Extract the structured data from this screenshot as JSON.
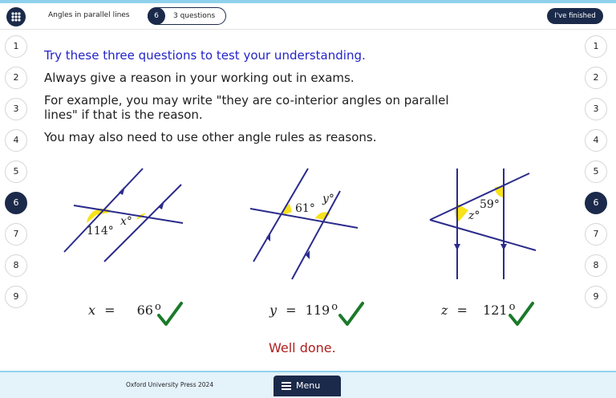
{
  "header": {
    "lesson_title": "Angles in parallel lines",
    "question_number": "6",
    "question_count": "3 questions",
    "finished_label": "I've finished"
  },
  "nav": {
    "items": [
      "1",
      "2",
      "3",
      "4",
      "5",
      "6",
      "7",
      "8",
      "9"
    ],
    "active": "6"
  },
  "content": {
    "intro": "Try these three questions to test your understanding.",
    "line2": "Always give a reason in your working out in exams.",
    "line3": "For example, you may write \"they are co-interior angles on parallel lines\" if that is the reason.",
    "line4": "You may also need to use other angle rules as reasons."
  },
  "figures": {
    "fig1": {
      "angle_given": "114°",
      "unknown": "x°"
    },
    "fig2": {
      "angle_given": "61°",
      "unknown": "y°"
    },
    "fig3": {
      "angle_given": "59°",
      "unknown": "z°"
    }
  },
  "answers": [
    {
      "var": "x",
      "eq": "=",
      "value": "66",
      "deg": "o"
    },
    {
      "var": "y",
      "eq": "=",
      "value": "119",
      "deg": "o"
    },
    {
      "var": "z",
      "eq": "=",
      "value": "121",
      "deg": "o"
    }
  ],
  "feedback": "Well done.",
  "footer": {
    "copyright": "Oxford University Press 2024",
    "menu_label": "Menu"
  },
  "colors": {
    "navy": "#1b2a4a",
    "line": "#2b2b8c",
    "angle_fill": "#f7e21b",
    "tick": "#1a7a2a",
    "feedback": "#b0201e",
    "intro": "#2424c8"
  }
}
